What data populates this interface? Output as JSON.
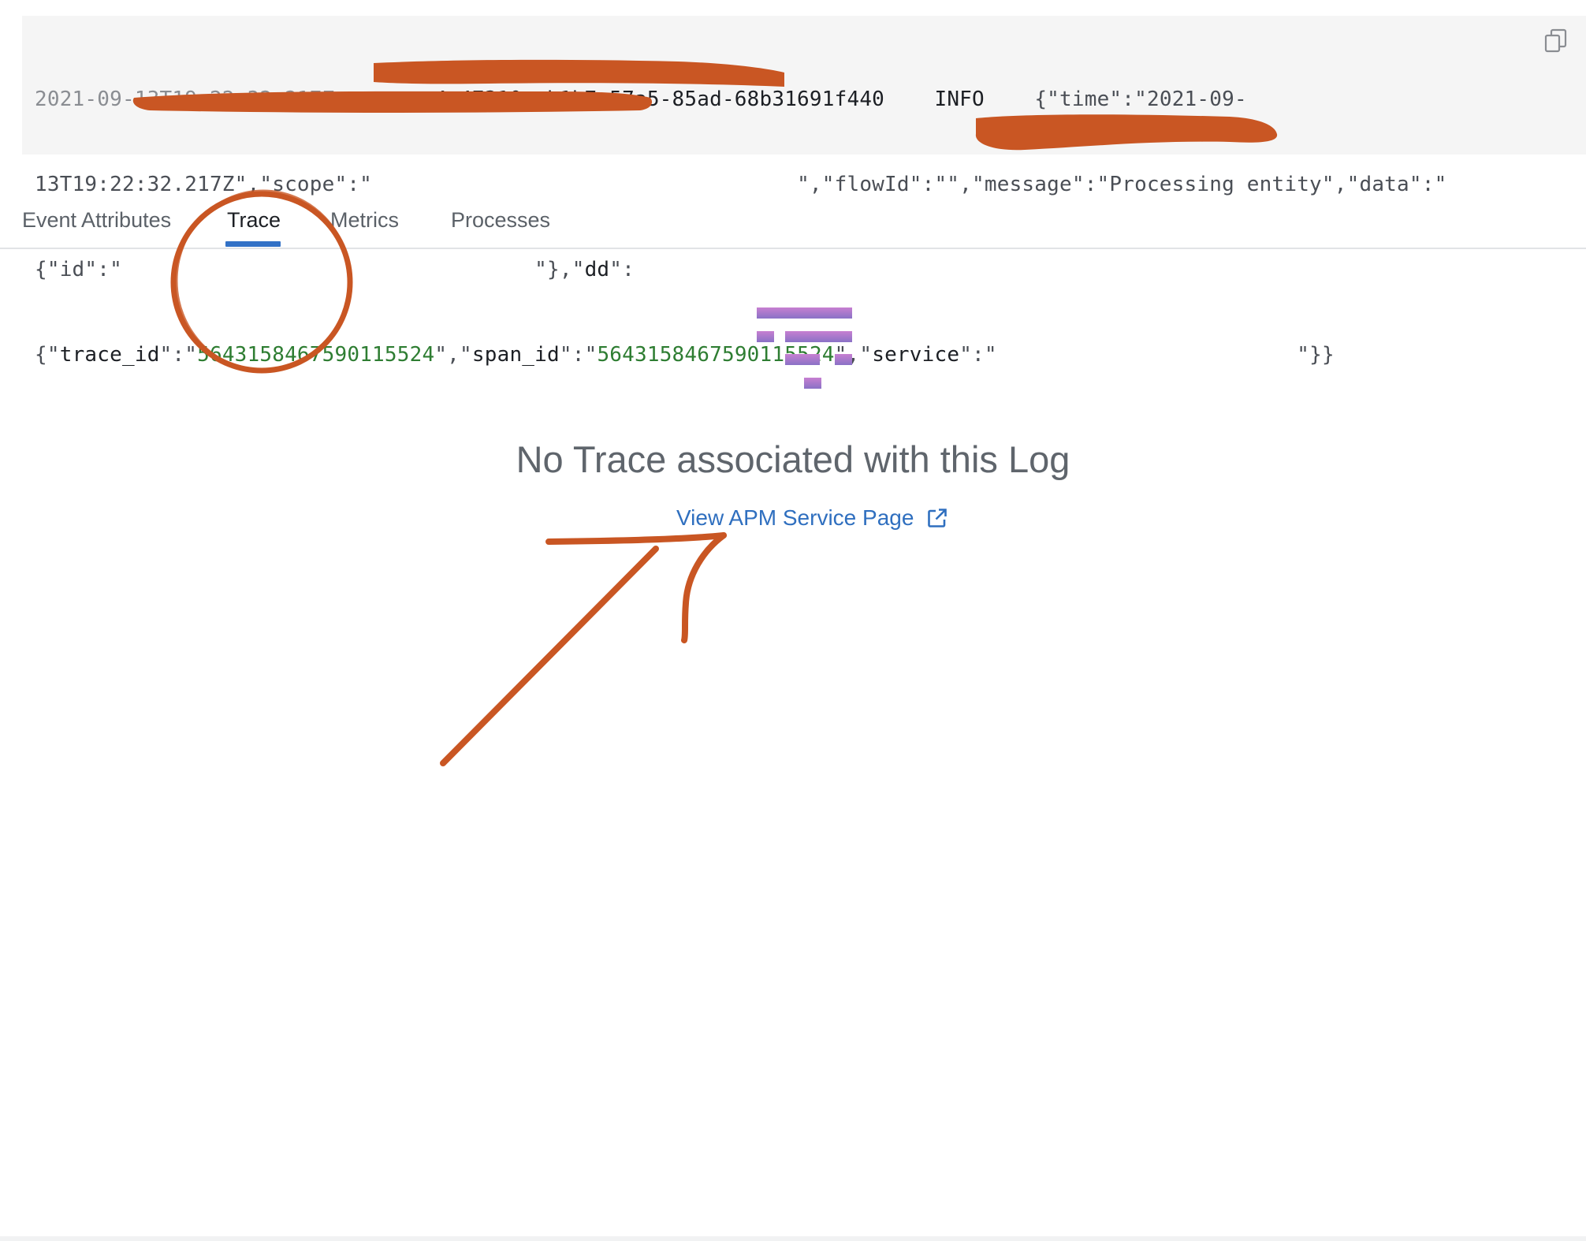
{
  "log": {
    "line1": {
      "timestamp": "2021-09-13T19:22:32.217Z",
      "trace_uuid": "4e47310a-b1b7-57a5-85ad-68b31691f440",
      "level": "INFO",
      "json_start": "{\"time\":\"2021-09-"
    },
    "line2": {
      "a": "13T19:22:32.217Z\",\"scope\":\"",
      "b": "\",\"flowId\":\"\",\"message\":\"Processing entity\",\"data\":\""
    },
    "line3": {
      "a": "{\"id\":\"",
      "b": "\"},\"",
      "key_dd": "dd",
      "c": "\":"
    },
    "line4": {
      "open": "{\"",
      "key_trace": "trace_id",
      "sep1": "\":\"",
      "trace_value": "5643158467590115524",
      "sep2": "\",\"",
      "key_span": "span_id",
      "sep3": "\":\"",
      "span_value": "5643158467590115524",
      "sep4": "\",\"",
      "key_service": "service",
      "sep5": "\":\"",
      "close": "\"}}"
    }
  },
  "tabs": [
    {
      "label": "Event Attributes"
    },
    {
      "label": "Trace",
      "active": true
    },
    {
      "label": "Metrics"
    },
    {
      "label": "Processes"
    }
  ],
  "empty_state": {
    "title": "No Trace associated with this Log",
    "link": "View APM Service Page"
  },
  "icons": {
    "copy": "copy-icon",
    "empty": "trace-waterfall-icon",
    "external": "external-link-icon"
  },
  "colors": {
    "accent": "#3271c6",
    "link": "#2f6fbf",
    "value_green": "#2e7d32",
    "annotation": "#c95623",
    "icon_top": "#c77fd1",
    "icon_bottom": "#8a72c6"
  }
}
